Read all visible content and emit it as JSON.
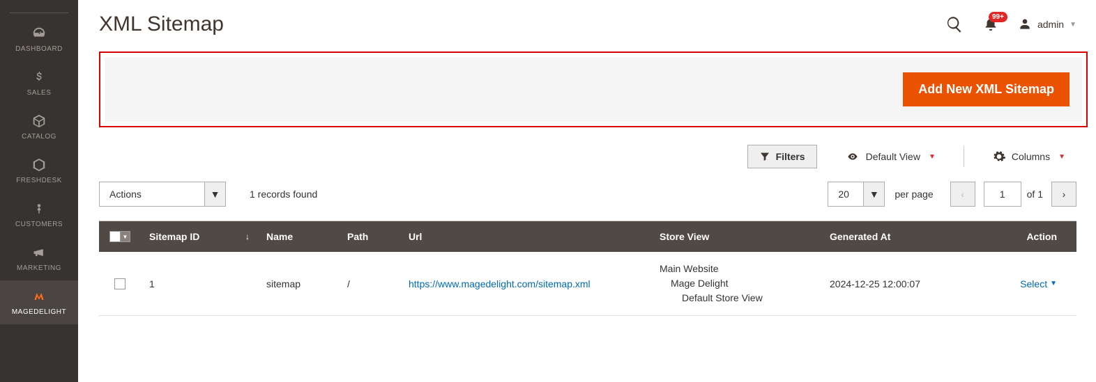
{
  "header": {
    "title": "XML Sitemap",
    "notification_badge": "99+",
    "user_name": "admin"
  },
  "sidebar": {
    "items": [
      {
        "label": "DASHBOARD"
      },
      {
        "label": "SALES"
      },
      {
        "label": "CATALOG"
      },
      {
        "label": "FRESHDESK"
      },
      {
        "label": "CUSTOMERS"
      },
      {
        "label": "MARKETING"
      },
      {
        "label": "MAGEDELIGHT"
      }
    ]
  },
  "primary_button": {
    "label": "Add New XML Sitemap"
  },
  "toolbar": {
    "filters_label": "Filters",
    "view_label": "Default View",
    "columns_label": "Columns"
  },
  "actions": {
    "dropdown_label": "Actions",
    "records_text": "1 records found",
    "per_page_value": "20",
    "per_page_label": "per page",
    "page_current": "1",
    "page_total": "of 1"
  },
  "table": {
    "columns": {
      "id": "Sitemap ID",
      "name": "Name",
      "path": "Path",
      "url": "Url",
      "store": "Store View",
      "generated": "Generated At",
      "action": "Action"
    },
    "rows": [
      {
        "id": "1",
        "name": "sitemap",
        "path": "/",
        "url": "https://www.magedelight.com/sitemap.xml",
        "store_l1": "Main Website",
        "store_l2": "Mage Delight",
        "store_l3": "Default Store View",
        "generated": "2024-12-25 12:00:07",
        "action_label": "Select"
      }
    ]
  }
}
